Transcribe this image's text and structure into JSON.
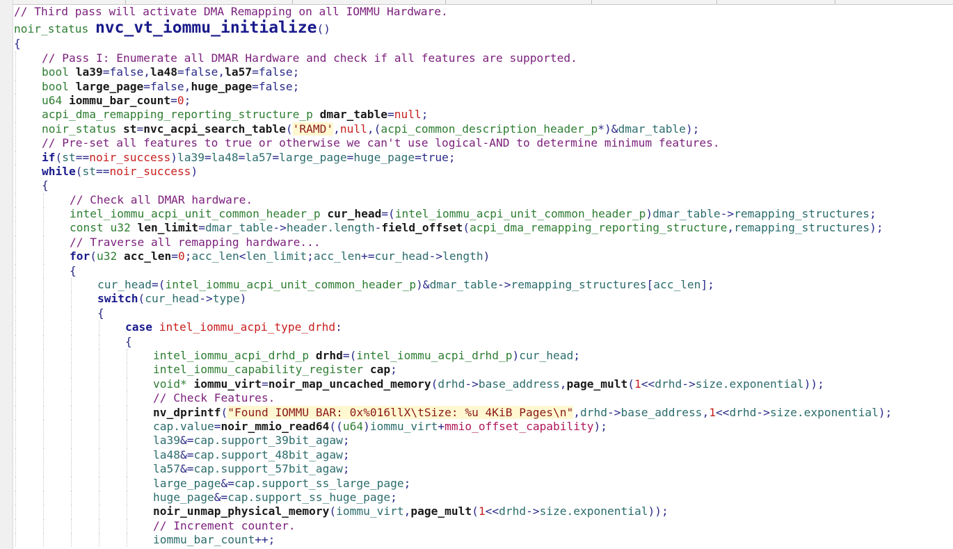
{
  "editor": {
    "language": "C",
    "lines": [
      {
        "indent": 0,
        "tokens": [
          {
            "t": "cmt",
            "v": "// Third pass will activate DMA Remapping on all IOMMU Hardware."
          }
        ]
      },
      {
        "indent": 0,
        "hdr": true,
        "tokens": [
          {
            "t": "ty",
            "v": "noir_status "
          },
          {
            "t": "fn-big",
            "v": "nvc_vt_iommu_initialize"
          },
          {
            "t": "op",
            "v": "()"
          }
        ]
      },
      {
        "indent": 0,
        "tokens": [
          {
            "t": "op",
            "v": "{"
          }
        ]
      },
      {
        "indent": 1,
        "tokens": [
          {
            "t": "cmt",
            "v": "// Pass I: Enumerate all DMAR Hardware and check if all features are supported."
          }
        ]
      },
      {
        "indent": 1,
        "tokens": [
          {
            "t": "ty",
            "v": "bool "
          },
          {
            "t": "nm",
            "v": "la39"
          },
          {
            "t": "op",
            "v": "=false,"
          },
          {
            "t": "nm",
            "v": "la48"
          },
          {
            "t": "op",
            "v": "=false,"
          },
          {
            "t": "nm",
            "v": "la57"
          },
          {
            "t": "op",
            "v": "=false;"
          }
        ]
      },
      {
        "indent": 1,
        "tokens": [
          {
            "t": "ty",
            "v": "bool "
          },
          {
            "t": "nm",
            "v": "large_page"
          },
          {
            "t": "op",
            "v": "=false,"
          },
          {
            "t": "nm",
            "v": "huge_page"
          },
          {
            "t": "op",
            "v": "=false;"
          }
        ]
      },
      {
        "indent": 1,
        "tokens": [
          {
            "t": "ty",
            "v": "u64 "
          },
          {
            "t": "nm",
            "v": "iommu_bar_count"
          },
          {
            "t": "op",
            "v": "="
          },
          {
            "t": "cn",
            "v": "0"
          },
          {
            "t": "op",
            "v": ";"
          }
        ]
      },
      {
        "indent": 1,
        "tokens": [
          {
            "t": "ty",
            "v": "acpi_dma_remapping_reporting_structure_p "
          },
          {
            "t": "nm",
            "v": "dmar_table"
          },
          {
            "t": "op",
            "v": "="
          },
          {
            "t": "cn",
            "v": "null"
          },
          {
            "t": "op",
            "v": ";"
          }
        ]
      },
      {
        "indent": 1,
        "tokens": [
          {
            "t": "ty",
            "v": "noir_status "
          },
          {
            "t": "nm",
            "v": "st"
          },
          {
            "t": "op",
            "v": "="
          },
          {
            "t": "fn",
            "v": "nvc_acpi_search_table"
          },
          {
            "t": "op",
            "v": "("
          },
          {
            "t": "str",
            "v": "'RAMD'"
          },
          {
            "t": "op",
            "v": ","
          },
          {
            "t": "cn",
            "v": "null"
          },
          {
            "t": "op",
            "v": ",("
          },
          {
            "t": "ty",
            "v": "acpi_common_description_header_p"
          },
          {
            "t": "op",
            "v": "*)&"
          },
          {
            "t": "id",
            "v": "dmar_table"
          },
          {
            "t": "op",
            "v": ");"
          }
        ]
      },
      {
        "indent": 1,
        "tokens": [
          {
            "t": "cmt",
            "v": "// Pre-set all features to true or otherwise we can't use logical-AND to determine minimum features."
          }
        ]
      },
      {
        "indent": 1,
        "tokens": [
          {
            "t": "kwb",
            "v": "if"
          },
          {
            "t": "op",
            "v": "("
          },
          {
            "t": "id",
            "v": "st"
          },
          {
            "t": "op",
            "v": "=="
          },
          {
            "t": "cn",
            "v": "noir_success"
          },
          {
            "t": "op",
            "v": ")"
          },
          {
            "t": "id",
            "v": "la39"
          },
          {
            "t": "op",
            "v": "="
          },
          {
            "t": "id",
            "v": "la48"
          },
          {
            "t": "op",
            "v": "="
          },
          {
            "t": "id",
            "v": "la57"
          },
          {
            "t": "op",
            "v": "="
          },
          {
            "t": "id",
            "v": "large_page"
          },
          {
            "t": "op",
            "v": "="
          },
          {
            "t": "id",
            "v": "huge_page"
          },
          {
            "t": "op",
            "v": "=true;"
          }
        ]
      },
      {
        "indent": 1,
        "tokens": [
          {
            "t": "kwb",
            "v": "while"
          },
          {
            "t": "op",
            "v": "("
          },
          {
            "t": "id",
            "v": "st"
          },
          {
            "t": "op",
            "v": "=="
          },
          {
            "t": "cn",
            "v": "noir_success"
          },
          {
            "t": "op",
            "v": ")"
          }
        ]
      },
      {
        "indent": 1,
        "tokens": [
          {
            "t": "op",
            "v": "{"
          }
        ]
      },
      {
        "indent": 2,
        "tokens": [
          {
            "t": "cmt",
            "v": "// Check all DMAR hardware."
          }
        ]
      },
      {
        "indent": 2,
        "tokens": [
          {
            "t": "ty",
            "v": "intel_iommu_acpi_unit_common_header_p "
          },
          {
            "t": "nm",
            "v": "cur_head"
          },
          {
            "t": "op",
            "v": "=("
          },
          {
            "t": "ty",
            "v": "intel_iommu_acpi_unit_common_header_p"
          },
          {
            "t": "op",
            "v": ")"
          },
          {
            "t": "id",
            "v": "dmar_table"
          },
          {
            "t": "op",
            "v": "->"
          },
          {
            "t": "id",
            "v": "remapping_structures"
          },
          {
            "t": "op",
            "v": ";"
          }
        ]
      },
      {
        "indent": 2,
        "tokens": [
          {
            "t": "ty",
            "v": "const u32 "
          },
          {
            "t": "nm",
            "v": "len_limit"
          },
          {
            "t": "op",
            "v": "="
          },
          {
            "t": "id",
            "v": "dmar_table"
          },
          {
            "t": "op",
            "v": "->"
          },
          {
            "t": "id",
            "v": "header.length"
          },
          {
            "t": "op",
            "v": "-"
          },
          {
            "t": "fn",
            "v": "field_offset"
          },
          {
            "t": "op",
            "v": "("
          },
          {
            "t": "ty",
            "v": "acpi_dma_remapping_reporting_structure"
          },
          {
            "t": "op",
            "v": ","
          },
          {
            "t": "id",
            "v": "remapping_structures"
          },
          {
            "t": "op",
            "v": ");"
          }
        ]
      },
      {
        "indent": 2,
        "tokens": [
          {
            "t": "cmt",
            "v": "// Traverse all remapping hardware..."
          }
        ]
      },
      {
        "indent": 2,
        "tokens": [
          {
            "t": "kwb",
            "v": "for"
          },
          {
            "t": "op",
            "v": "("
          },
          {
            "t": "ty",
            "v": "u32 "
          },
          {
            "t": "nm",
            "v": "acc_len"
          },
          {
            "t": "op",
            "v": "="
          },
          {
            "t": "cn",
            "v": "0"
          },
          {
            "t": "op",
            "v": ";"
          },
          {
            "t": "id",
            "v": "acc_len"
          },
          {
            "t": "op",
            "v": "<"
          },
          {
            "t": "id",
            "v": "len_limit"
          },
          {
            "t": "op",
            "v": ";"
          },
          {
            "t": "id",
            "v": "acc_len"
          },
          {
            "t": "op",
            "v": "+="
          },
          {
            "t": "id",
            "v": "cur_head"
          },
          {
            "t": "op",
            "v": "->"
          },
          {
            "t": "id",
            "v": "length"
          },
          {
            "t": "op",
            "v": ")"
          }
        ]
      },
      {
        "indent": 2,
        "tokens": [
          {
            "t": "op",
            "v": "{"
          }
        ]
      },
      {
        "indent": 3,
        "tokens": [
          {
            "t": "id",
            "v": "cur_head"
          },
          {
            "t": "op",
            "v": "=("
          },
          {
            "t": "ty",
            "v": "intel_iommu_acpi_unit_common_header_p"
          },
          {
            "t": "op",
            "v": ")&"
          },
          {
            "t": "id",
            "v": "dmar_table"
          },
          {
            "t": "op",
            "v": "->"
          },
          {
            "t": "id",
            "v": "remapping_structures"
          },
          {
            "t": "op",
            "v": "["
          },
          {
            "t": "id",
            "v": "acc_len"
          },
          {
            "t": "op",
            "v": "];"
          }
        ]
      },
      {
        "indent": 3,
        "tokens": [
          {
            "t": "kwb",
            "v": "switch"
          },
          {
            "t": "op",
            "v": "("
          },
          {
            "t": "id",
            "v": "cur_head"
          },
          {
            "t": "op",
            "v": "->"
          },
          {
            "t": "id",
            "v": "type"
          },
          {
            "t": "op",
            "v": ")"
          }
        ]
      },
      {
        "indent": 3,
        "tokens": [
          {
            "t": "op",
            "v": "{"
          }
        ]
      },
      {
        "indent": 4,
        "tokens": [
          {
            "t": "kwb",
            "v": "case "
          },
          {
            "t": "cn",
            "v": "intel_iommu_acpi_type_drhd"
          },
          {
            "t": "op",
            "v": ":"
          }
        ]
      },
      {
        "indent": 4,
        "tokens": [
          {
            "t": "op",
            "v": "{"
          }
        ]
      },
      {
        "indent": 5,
        "tokens": [
          {
            "t": "ty",
            "v": "intel_iommu_acpi_drhd_p "
          },
          {
            "t": "nm",
            "v": "drhd"
          },
          {
            "t": "op",
            "v": "=("
          },
          {
            "t": "ty",
            "v": "intel_iommu_acpi_drhd_p"
          },
          {
            "t": "op",
            "v": ")"
          },
          {
            "t": "id",
            "v": "cur_head"
          },
          {
            "t": "op",
            "v": ";"
          }
        ]
      },
      {
        "indent": 5,
        "tokens": [
          {
            "t": "ty",
            "v": "intel_iommu_capability_register "
          },
          {
            "t": "nm",
            "v": "cap"
          },
          {
            "t": "op",
            "v": ";"
          }
        ]
      },
      {
        "indent": 5,
        "tokens": [
          {
            "t": "ty",
            "v": "void* "
          },
          {
            "t": "nm",
            "v": "iommu_virt"
          },
          {
            "t": "op",
            "v": "="
          },
          {
            "t": "fn",
            "v": "noir_map_uncached_memory"
          },
          {
            "t": "op",
            "v": "("
          },
          {
            "t": "id",
            "v": "drhd"
          },
          {
            "t": "op",
            "v": "->"
          },
          {
            "t": "id",
            "v": "base_address"
          },
          {
            "t": "op",
            "v": ","
          },
          {
            "t": "fn",
            "v": "page_mult"
          },
          {
            "t": "op",
            "v": "("
          },
          {
            "t": "cn",
            "v": "1"
          },
          {
            "t": "op",
            "v": "<<"
          },
          {
            "t": "id",
            "v": "drhd"
          },
          {
            "t": "op",
            "v": "->"
          },
          {
            "t": "id",
            "v": "size.exponential"
          },
          {
            "t": "op",
            "v": "));"
          }
        ]
      },
      {
        "indent": 5,
        "tokens": [
          {
            "t": "cmt",
            "v": "// Check Features."
          }
        ]
      },
      {
        "indent": 5,
        "tokens": [
          {
            "t": "fn",
            "v": "nv_dprintf"
          },
          {
            "t": "op",
            "v": "("
          },
          {
            "t": "str",
            "v": "\"Found IOMMU BAR: 0x%016llX\\tSize: %u 4KiB Pages\\n\""
          },
          {
            "t": "op",
            "v": ","
          },
          {
            "t": "id",
            "v": "drhd"
          },
          {
            "t": "op",
            "v": "->"
          },
          {
            "t": "id",
            "v": "base_address"
          },
          {
            "t": "op",
            "v": ","
          },
          {
            "t": "cn",
            "v": "1"
          },
          {
            "t": "op",
            "v": "<<"
          },
          {
            "t": "id",
            "v": "drhd"
          },
          {
            "t": "op",
            "v": "->"
          },
          {
            "t": "id",
            "v": "size.exponential"
          },
          {
            "t": "op",
            "v": ");"
          }
        ]
      },
      {
        "indent": 5,
        "tokens": [
          {
            "t": "id",
            "v": "cap.value"
          },
          {
            "t": "op",
            "v": "="
          },
          {
            "t": "fn",
            "v": "noir_mmio_read64"
          },
          {
            "t": "op",
            "v": "(("
          },
          {
            "t": "ty",
            "v": "u64"
          },
          {
            "t": "op",
            "v": ")"
          },
          {
            "t": "id",
            "v": "iommu_virt"
          },
          {
            "t": "op",
            "v": "+"
          },
          {
            "t": "mac",
            "v": "mmio_offset_capability"
          },
          {
            "t": "op",
            "v": ");"
          }
        ]
      },
      {
        "indent": 5,
        "tokens": [
          {
            "t": "id",
            "v": "la39"
          },
          {
            "t": "op",
            "v": "&="
          },
          {
            "t": "id",
            "v": "cap.support_39bit_agaw"
          },
          {
            "t": "op",
            "v": ";"
          }
        ]
      },
      {
        "indent": 5,
        "tokens": [
          {
            "t": "id",
            "v": "la48"
          },
          {
            "t": "op",
            "v": "&="
          },
          {
            "t": "id",
            "v": "cap.support_48bit_agaw"
          },
          {
            "t": "op",
            "v": ";"
          }
        ]
      },
      {
        "indent": 5,
        "tokens": [
          {
            "t": "id",
            "v": "la57"
          },
          {
            "t": "op",
            "v": "&="
          },
          {
            "t": "id",
            "v": "cap.support_57bit_agaw"
          },
          {
            "t": "op",
            "v": ";"
          }
        ]
      },
      {
        "indent": 5,
        "tokens": [
          {
            "t": "id",
            "v": "large_page"
          },
          {
            "t": "op",
            "v": "&="
          },
          {
            "t": "id",
            "v": "cap.support_ss_large_page"
          },
          {
            "t": "op",
            "v": ";"
          }
        ]
      },
      {
        "indent": 5,
        "tokens": [
          {
            "t": "id",
            "v": "huge_page"
          },
          {
            "t": "op",
            "v": "&="
          },
          {
            "t": "id",
            "v": "cap.support_ss_huge_page"
          },
          {
            "t": "op",
            "v": ";"
          }
        ]
      },
      {
        "indent": 5,
        "tokens": [
          {
            "t": "fn",
            "v": "noir_unmap_physical_memory"
          },
          {
            "t": "op",
            "v": "("
          },
          {
            "t": "id",
            "v": "iommu_virt"
          },
          {
            "t": "op",
            "v": ","
          },
          {
            "t": "fn",
            "v": "page_mult"
          },
          {
            "t": "op",
            "v": "("
          },
          {
            "t": "cn",
            "v": "1"
          },
          {
            "t": "op",
            "v": "<<"
          },
          {
            "t": "id",
            "v": "drhd"
          },
          {
            "t": "op",
            "v": "->"
          },
          {
            "t": "id",
            "v": "size.exponential"
          },
          {
            "t": "op",
            "v": "));"
          }
        ]
      },
      {
        "indent": 5,
        "tokens": [
          {
            "t": "cmt",
            "v": "// Increment counter."
          }
        ]
      },
      {
        "indent": 5,
        "tokens": [
          {
            "t": "id",
            "v": "iommu_bar_count"
          },
          {
            "t": "op",
            "v": "++;"
          }
        ]
      }
    ]
  }
}
